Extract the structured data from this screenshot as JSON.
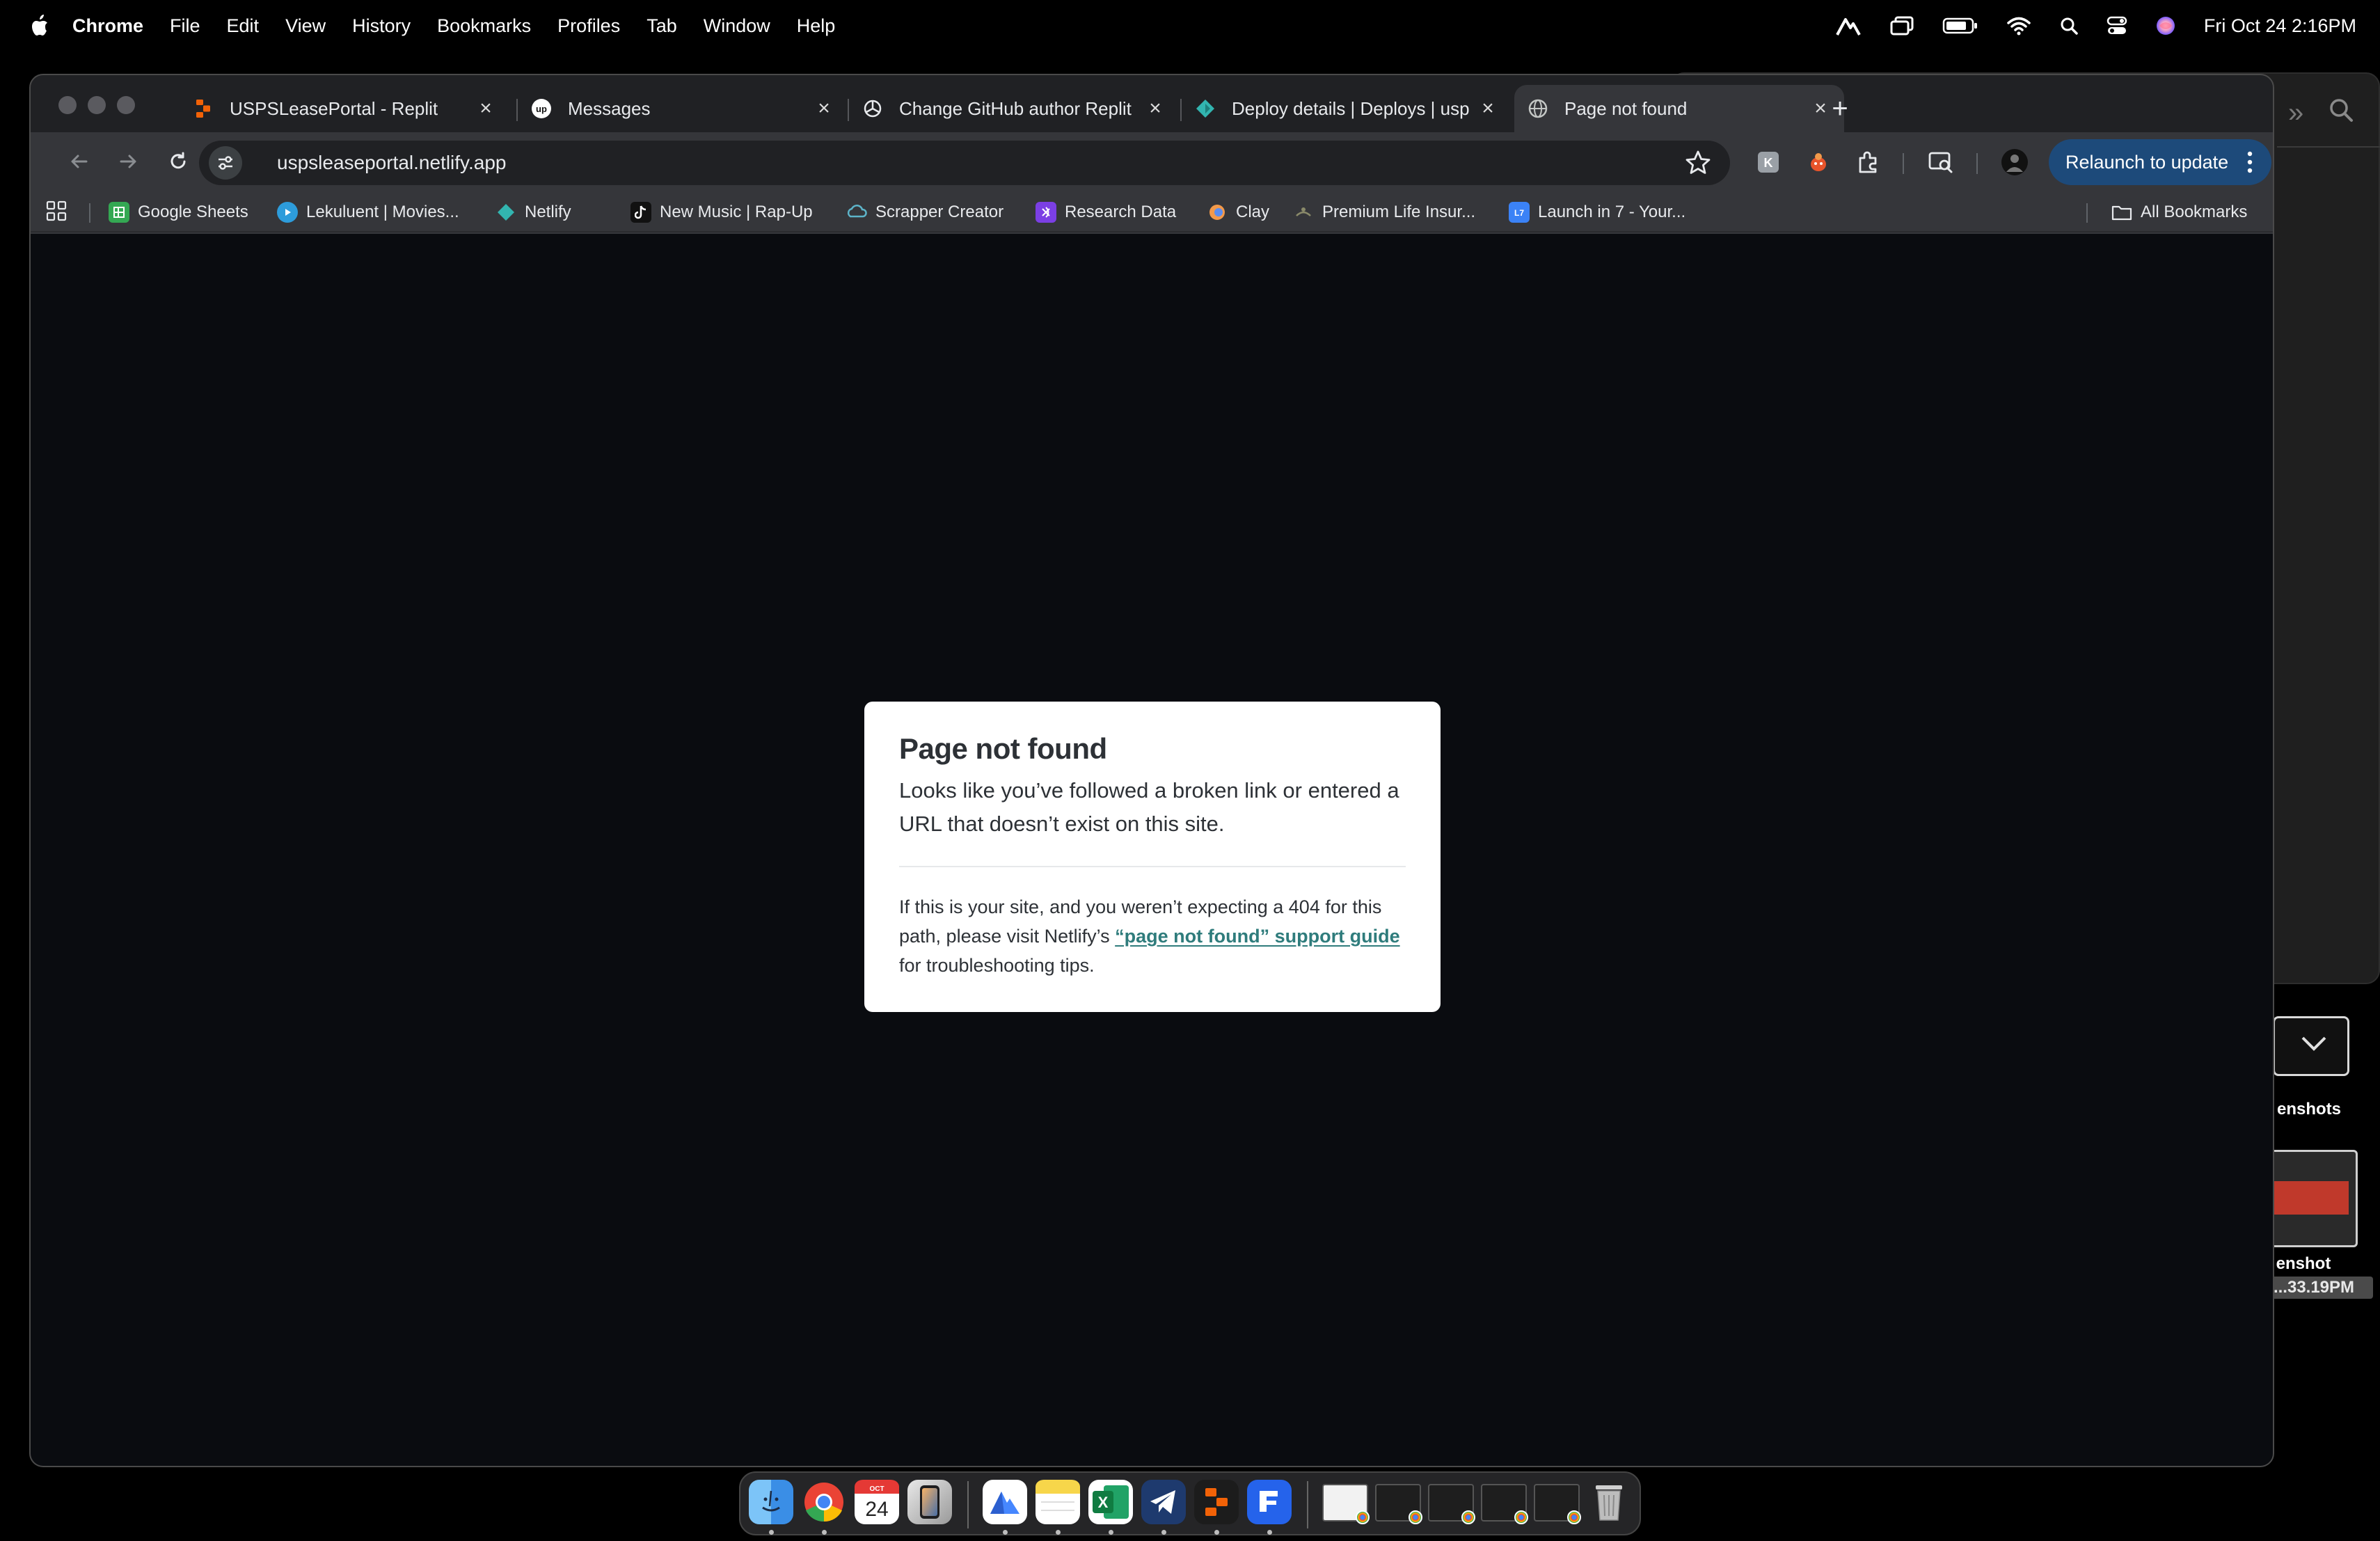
{
  "menubar": {
    "items": [
      "Chrome",
      "File",
      "Edit",
      "View",
      "History",
      "Bookmarks",
      "Profiles",
      "Tab",
      "Window",
      "Help"
    ],
    "clock": "Fri Oct 24  2:16PM",
    "status_icons": [
      "vpn-icon",
      "stage-manager-icon",
      "battery-icon",
      "wifi-icon",
      "spotlight-icon",
      "control-center-icon",
      "siri-icon"
    ]
  },
  "browser": {
    "tabs": [
      {
        "title": "USPSLeasePortal - Replit",
        "icon": "replit-icon",
        "active": false
      },
      {
        "title": "Messages",
        "icon": "upwork-icon",
        "active": false
      },
      {
        "title": "Change GitHub author Replit",
        "icon": "openai-icon",
        "active": false
      },
      {
        "title": "Deploy details | Deploys | usp",
        "icon": "netlify-icon",
        "active": false
      },
      {
        "title": "Page not found",
        "icon": "globe-icon",
        "active": true
      }
    ],
    "new_tab": "+",
    "tab_close": "×",
    "url": "uspsleaseportal.netlify.app",
    "relaunch_label": "Relaunch to update",
    "bookmarks": [
      {
        "label": "Google Sheets",
        "icon": "google-sheets-icon",
        "color": "#34a853"
      },
      {
        "label": "Lekuluent | Movies...",
        "icon": "play-icon",
        "color": "#2d9cdb"
      },
      {
        "label": "Netlify",
        "icon": "netlify-icon",
        "color": "#32b5b0"
      },
      {
        "label": "New Music | Rap-Up",
        "icon": "tiktok-icon",
        "color": "#111111"
      },
      {
        "label": "Scrapper Creator",
        "icon": "cloud-icon",
        "color": "#5db4c9"
      },
      {
        "label": "Research Data",
        "icon": "research-icon",
        "color": "#7b3fe4"
      },
      {
        "label": "Clay",
        "icon": "clay-icon",
        "color": "#f2994a"
      },
      {
        "label": "Premium Life Insur...",
        "icon": "insurance-icon",
        "color": "#8a8a6a"
      },
      {
        "label": "Launch in 7 - Your...",
        "icon": "l7-icon",
        "color": "#3b82f6"
      }
    ],
    "all_bookmarks": "All Bookmarks"
  },
  "page": {
    "title": "Page not found",
    "lead": "Looks like you’ve followed a broken link or entered a URL that doesn’t exist on this site.",
    "help_before": "If this is your site, and you weren’t expecting a 404 for this path, please visit Netlify’s ",
    "help_link": "“page not found” support guide",
    "help_after": " for troubleshooting tips."
  },
  "desktop": {
    "folder_label": "enshots",
    "file_label_1": "enshot",
    "file_label_2": "...33.19PM"
  },
  "dock": {
    "apps": [
      "finder-icon",
      "chrome-icon",
      "calendar-icon",
      "iphone-mirroring-icon",
      "nordvpn-icon",
      "notes-icon",
      "excel-icon",
      "telegram-icon",
      "replit-icon",
      "framer-icon"
    ],
    "calendar_month": "OCT",
    "calendar_day": "24",
    "excel_letter": "X"
  }
}
